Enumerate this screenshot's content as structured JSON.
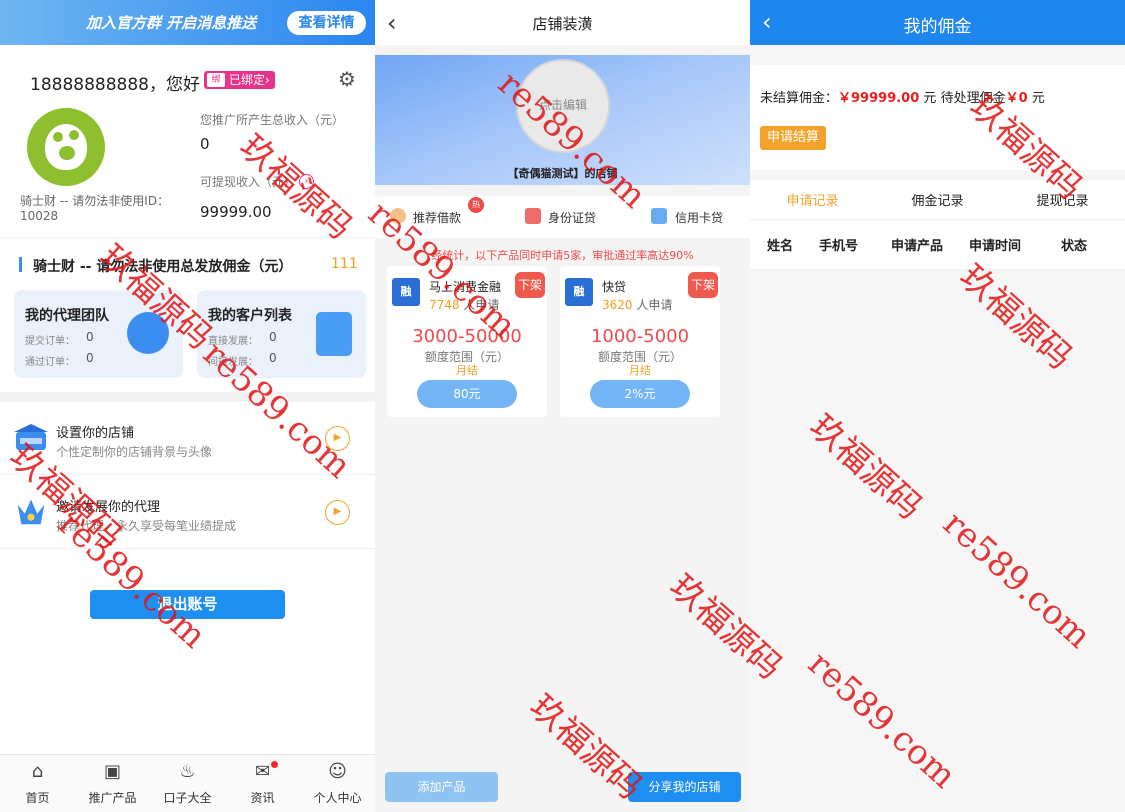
{
  "panel1": {
    "banner": {
      "text": "加入官方群 开启消息推送",
      "button": "查看详情"
    },
    "user": {
      "phone": "18888888888，您好",
      "bound": "已绑定",
      "bound_icon": "绑",
      "name_line": "骑士财 -- 请勿法非使用ID：10028"
    },
    "income": {
      "label": "您推广所产生总收入（元）",
      "value": "0"
    },
    "withdraw": {
      "label": "可提现收入（元）",
      "value": "99999.00"
    },
    "section": {
      "title": "骑士财 -- 请勿法非使用总发放佣金（元）",
      "value": "111"
    },
    "team_card": {
      "title": "我的代理团队",
      "line1_label": "提交订单：",
      "line1_value": "0",
      "line2_label": "通过订单：",
      "line2_value": "0"
    },
    "customer_card": {
      "title": "我的客户列表",
      "line1_label": "直接发展：",
      "line1_value": "0",
      "line2_label": "间接发展：",
      "line2_value": "0"
    },
    "rows": [
      {
        "title": "设置你的店铺",
        "sub": "个性定制你的店铺背景与头像"
      },
      {
        "title": "邀请发展你的代理",
        "sub": "推荐代理，永久享受每笔业绩提成"
      }
    ],
    "logout": "退出账号",
    "tabs": [
      {
        "label": "首页",
        "icon": "home-icon"
      },
      {
        "label": "推广产品",
        "icon": "wallet-icon"
      },
      {
        "label": "口子大全",
        "icon": "fire-icon"
      },
      {
        "label": "资讯",
        "icon": "message-icon"
      },
      {
        "label": "个人中心",
        "icon": "user-icon"
      }
    ]
  },
  "panel2": {
    "title": "店铺装潢",
    "avatar_edit": "点击编辑",
    "shop_name": "【奇偶猫测试】的店铺",
    "categories": [
      "推荐借款",
      "身份证贷",
      "信用卡贷"
    ],
    "hot": "热",
    "notice": "经统计，以下产品同时申请5家，审批通过率高达90%",
    "products": [
      {
        "logo": "融",
        "name": "马上消费金融",
        "count": "7748",
        "count_suffix": "人申请",
        "off": "下架",
        "range": "3000-50000",
        "range_label": "额度范围（元）",
        "period": "月结",
        "button": "80元"
      },
      {
        "logo": "融",
        "name": "快贷",
        "count": "3620",
        "count_suffix": "人申请",
        "off": "下架",
        "range": "1000-5000",
        "range_label": "额度范围（元）",
        "period": "月结",
        "button": "2%元"
      }
    ],
    "add_button": "添加产品",
    "share_button": "分享我的店铺"
  },
  "panel3": {
    "title": "我的佣金",
    "unsettled_label": "未结算佣金：",
    "unsettled_value": "￥99999.00",
    "unsettled_unit": "元",
    "pending_label": "待处理佣金",
    "pending_value": "￥0",
    "pending_unit": "元",
    "settle_button": "申请结算",
    "tabs": [
      "申请记录",
      "佣金记录",
      "提现记录"
    ],
    "columns": [
      "姓名",
      "手机号",
      "申请产品",
      "申请时间",
      "状态"
    ]
  },
  "watermark": {
    "cn": "玖福源码",
    "url": "re589.com"
  },
  "colors": {
    "primary": "#1e86ef",
    "accent": "#f3a32c",
    "danger": "#ef4b4b",
    "watermark": "#e01515"
  }
}
